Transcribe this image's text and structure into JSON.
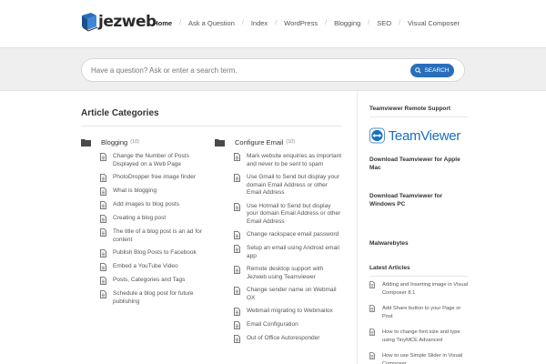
{
  "brand": {
    "name": "jezweb"
  },
  "nav": {
    "items": [
      {
        "label": "Home",
        "active": true
      },
      {
        "label": "Ask a Question"
      },
      {
        "label": "Index"
      },
      {
        "label": "WordPress"
      },
      {
        "label": "Blogging"
      },
      {
        "label": "SEO"
      },
      {
        "label": "Visual Composer"
      }
    ],
    "separator": "/"
  },
  "search": {
    "placeholder": "Have a question? Ask or enter a search term.",
    "button_label": "SEARCH"
  },
  "main": {
    "title": "Article Categories",
    "categories": [
      {
        "title": "Blogging",
        "count": "(10)",
        "articles": [
          "Change the Number of Posts Displayed on a Web Page",
          "PhotoDropper free image finder",
          "What is blogging",
          "Add images to blog posts",
          "Creating a blog post",
          "The title of a blog post is an ad for content",
          "Publish Blog Posts to Facebook",
          "Embed a YouTube Video",
          "Posts, Categories and Tags",
          "Schedule a blog post for future publishing"
        ]
      },
      {
        "title": "Configure Email",
        "count": "(10)",
        "articles": [
          "Mark website enquiries as important and never to be sent to spam",
          "Use Gmail to Send but display your domain Email Address or other Email Address",
          "Use Hotmail to Send but display your domain Email Address or other Email Address",
          "Change rackspace email password",
          "Setup an email using Android email app",
          "Remote desktop support with Jezweb using Teamviewer",
          "Change sender name on Webmail OX",
          "Webmail migrating to Webmailox",
          "Email Configuration",
          "Out of Office Autoresponder"
        ]
      }
    ]
  },
  "sidebar": {
    "teamviewer_title": "Teamviewer Remote Support",
    "teamviewer_logo_text": "TeamViewer",
    "download_mac": "Download Teamviewer for Apple Mac",
    "download_windows": "Download Teamviewer for Windows PC",
    "malwarebytes": "Malwarebytes",
    "latest_title": "Latest Articles",
    "latest_articles": [
      "Adding and Inserting image in Visual Composer 8.1",
      "Add Share button to your Page or Post",
      "How to change font size and type using TinyMCE Advanced",
      "How to use Simple Slider in Visual Composer"
    ]
  },
  "colors": {
    "accent": "#2a6ebb",
    "teamviewer_blue": "#1a6fc0",
    "search_band": "#efeff0"
  },
  "icons": {
    "folder": "folder-icon",
    "document": "document-icon",
    "search": "search-icon"
  }
}
